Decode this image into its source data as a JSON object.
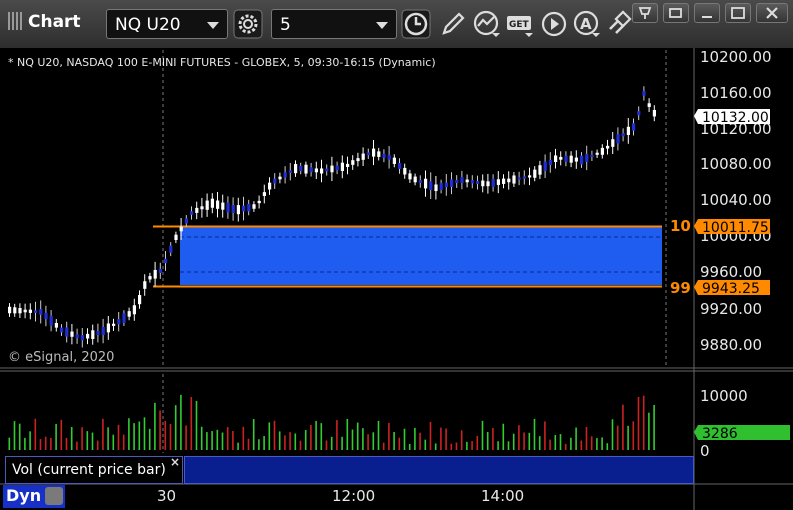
{
  "app": {
    "title": "Chart"
  },
  "toolbar": {
    "symbol": "NQ U20",
    "interval": "5",
    "buttons": [
      "settings-icon",
      "clock-icon",
      "pencil-icon",
      "study-icon",
      "get-icon",
      "play-icon",
      "alert-icon",
      "link-icon"
    ]
  },
  "chart": {
    "header": "* NQ U20, NASDAQ 100 E-MINI FUTURES - GLOBEX, 5, 09:30-16:15 (Dynamic)",
    "watermark": "© eSignal, 2020",
    "price_axis": [
      "10200.00",
      "10160.00",
      "10120.00",
      "10080.00",
      "10040.00",
      "10000.00",
      "9960.00",
      "9920.00",
      "9880.00"
    ],
    "last_price": "10132.00",
    "zone_top_label": "10011.75",
    "zone_bottom_label": "9943.25",
    "zone_top_short": "10",
    "zone_bottom_short": "99",
    "time_axis": [
      "30",
      "12:00",
      "14:00"
    ]
  },
  "volume": {
    "axis": [
      "10000",
      "0"
    ],
    "last_volume": "3286",
    "legend": "Vol (current price bar)",
    "close": "×"
  },
  "footer": {
    "mode": "Dyn"
  },
  "colors": {
    "background": "#000000",
    "zone": "#1f5cf0",
    "zone_line": "#ff8a00",
    "up_candle": "#ffffff",
    "down_candle": "#1f2fd6",
    "volume_up": "#33cc33",
    "volume_down": "#cc2222",
    "volume_badge": "#2fbf2f"
  }
}
